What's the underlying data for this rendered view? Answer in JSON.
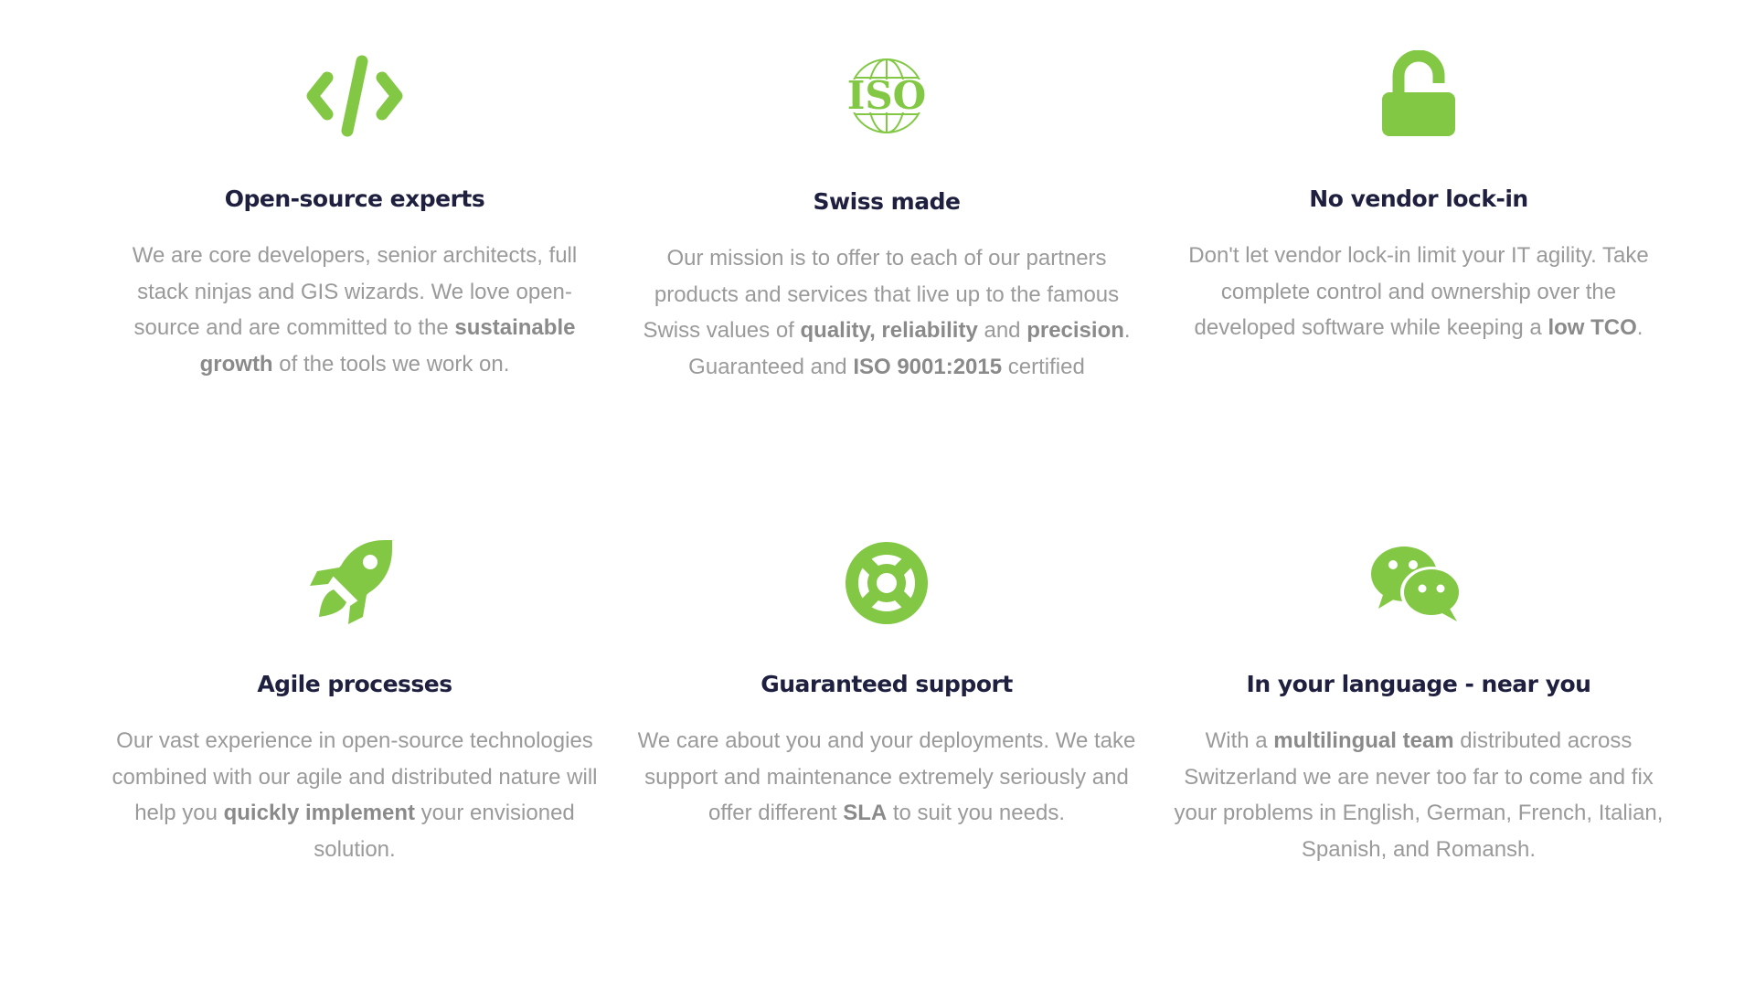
{
  "colors": {
    "accent": "#82c844",
    "title": "#1f2040",
    "body_text": "#9a9a9a"
  },
  "features": [
    {
      "icon": "code-icon",
      "title": "Open-source experts",
      "text": {
        "p1": "We are core developers, senior architects, full stack ninjas and GIS wizards. We love open-source and are committed to the ",
        "b1": "sustainable growth",
        "p2": " of the tools we work on."
      }
    },
    {
      "icon": "iso-icon",
      "icon_text": "ISO",
      "title": "Swiss made",
      "text": {
        "p1": "Our mission is to offer to each of our partners products and services that live up to the famous Swiss values of ",
        "b1": "quality, reliability",
        "p2": " and ",
        "b2": "precision",
        "p3": ". Guaranteed and ",
        "b3": "ISO 9001:2015",
        "p4": " certified"
      }
    },
    {
      "icon": "unlock-icon",
      "title": "No vendor lock-in",
      "text": {
        "p1": "Don't let vendor lock-in limit your IT agility. Take complete control and ownership over the developed software while keeping a ",
        "b1": "low TCO",
        "p2": "."
      }
    },
    {
      "icon": "rocket-icon",
      "title": "Agile processes",
      "text": {
        "p1": "Our vast experience in open-source technologies combined with our agile and distributed nature will help you ",
        "b1": "quickly implement",
        "p2": " your envisioned solution."
      }
    },
    {
      "icon": "lifebuoy-icon",
      "title": "Guaranteed support",
      "text": {
        "p1": "We care about you and your deployments. We take support and maintenance extremely seriously and offer different ",
        "b1": "SLA",
        "p2": " to suit you needs."
      }
    },
    {
      "icon": "chat-bubbles-icon",
      "title": "In your language - near you",
      "text": {
        "p1": "With a ",
        "b1": "multilingual team",
        "p2": " distributed across Switzerland we are never too far to come and fix your problems in English, German, French, Italian, Spanish, and Romansh."
      }
    }
  ]
}
